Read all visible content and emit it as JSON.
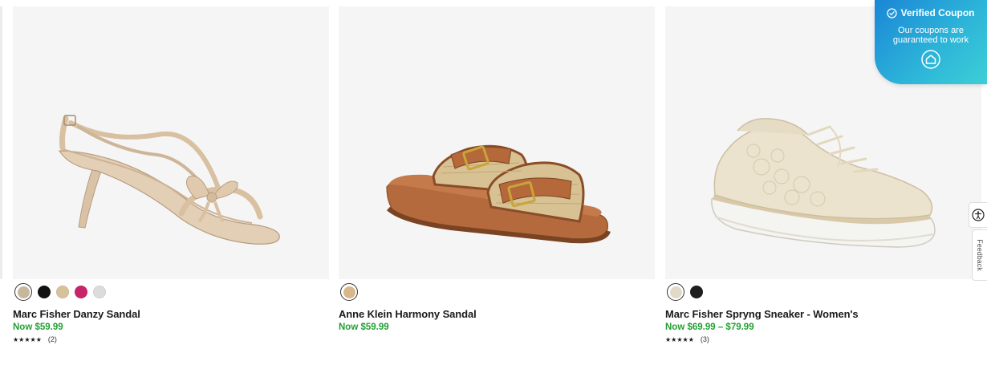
{
  "products": [
    {
      "name": "Marc Fisher Danzy Sandal",
      "price": "Now $59.99",
      "stars": "★★★★★",
      "reviews": "(2)",
      "swatches": [
        "#c9b79c",
        "#111111",
        "#d6c39c",
        "#c8246a",
        "#dcdcdc"
      ],
      "selected_swatch": 0
    },
    {
      "name": "Anne Klein Harmony Sandal",
      "price": "Now $59.99",
      "swatches": [
        "#d8b88a"
      ],
      "selected_swatch": 0
    },
    {
      "name": "Marc Fisher Spryng Sneaker - Women's",
      "price": "Now $69.99 – $79.99",
      "stars": "★★★★★",
      "reviews": "(3)",
      "swatches": [
        "#e2dac8",
        "#1e1e1e"
      ],
      "selected_swatch": 0
    }
  ],
  "coupon": {
    "title": "Verified Coupon",
    "subtitle": "Our coupons are guaranteed to work",
    "gradient_start": "#1a86d6",
    "gradient_end": "#3ccfd6"
  },
  "feedback_label": "Feedback",
  "accessibility_icon": "accessibility-icon",
  "accent_price_color": "#22a033"
}
